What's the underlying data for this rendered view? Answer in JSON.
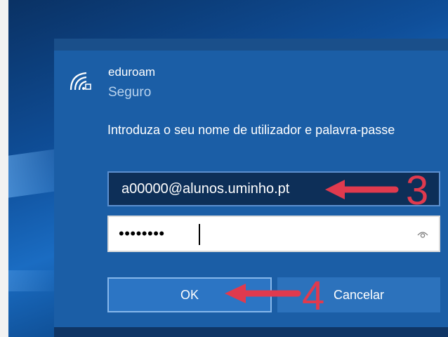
{
  "network": {
    "name": "eduroam",
    "status": "Seguro",
    "icon": "wifi-secured-icon"
  },
  "prompt": "Introduza o seu nome de utilizador e palavra-passe",
  "username_field": {
    "value": "a00000@alunos.uminho.pt"
  },
  "password_field": {
    "masked_value": "••••••••",
    "reveal_icon": "eye-icon"
  },
  "buttons": {
    "ok_label": "OK",
    "cancel_label": "Cancelar"
  },
  "annotations": {
    "step_username": "3",
    "step_ok": "4",
    "color": "#e03a4e"
  },
  "colors": {
    "panel": "#1b5ea6",
    "username_field_bg": "#0d2f58",
    "accent_border": "#86b7ea"
  }
}
